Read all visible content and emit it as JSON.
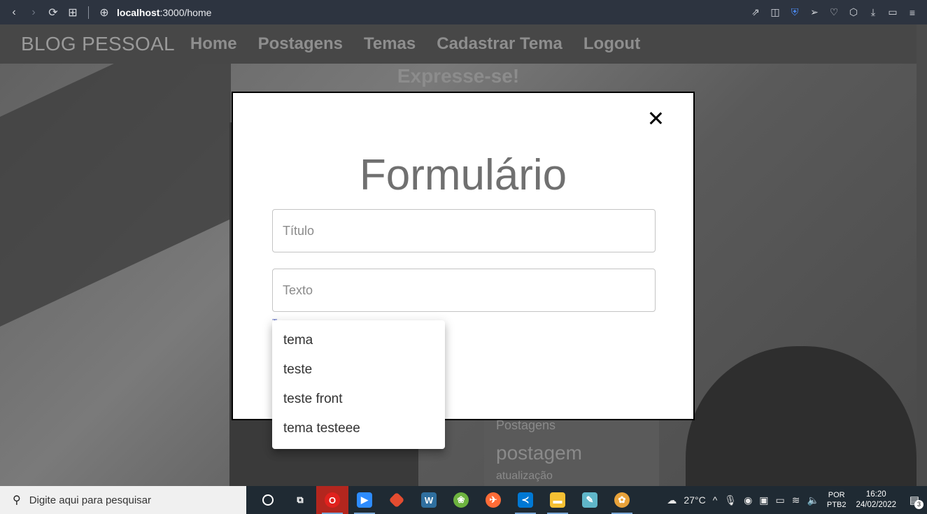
{
  "browser": {
    "url_host": "localhost",
    "url_path": ":3000/home",
    "back_icon": "‹",
    "forward_icon": "›",
    "reload_icon": "⟳",
    "tabs_icon": "⊞",
    "site_icon": "⊕"
  },
  "app": {
    "brand": "BLOG PESSOAL",
    "nav": [
      "Home",
      "Postagens",
      "Temas",
      "Cadastrar Tema",
      "Logout"
    ],
    "hero_title": "Expresse-se!",
    "card": {
      "label": "Postagens",
      "title": "postagem",
      "subtitle": "atualização"
    }
  },
  "modal": {
    "title": "Formulário",
    "close_icon": "close-icon",
    "fields": {
      "title_placeholder": "Título",
      "text_placeholder": "Texto"
    },
    "select_label": "T"
  },
  "menu": {
    "options": [
      "tema",
      "teste",
      "teste front",
      "tema testeee"
    ]
  },
  "taskbar": {
    "search_placeholder": "Digite aqui para pesquisar",
    "weather": "27°C",
    "lang_top": "POR",
    "lang_bottom": "PTB2",
    "time": "16:20",
    "date": "24/02/2022",
    "notifications": "3"
  },
  "colors": {
    "accent": "#3f51b5",
    "taskbar": "#1f2a33",
    "browser": "#2d3440"
  }
}
